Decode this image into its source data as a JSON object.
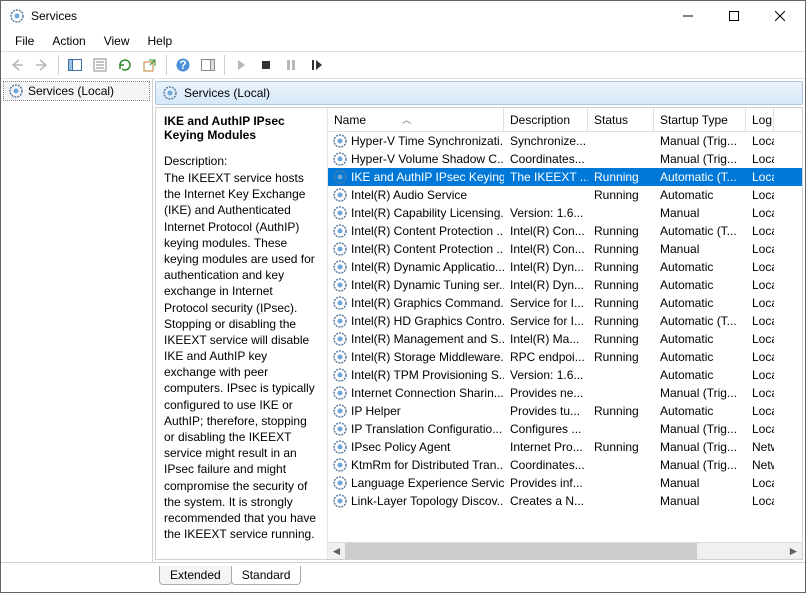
{
  "window": {
    "title": "Services"
  },
  "menu": {
    "file": "File",
    "action": "Action",
    "view": "View",
    "help": "Help"
  },
  "tree": {
    "root": "Services (Local)"
  },
  "panel": {
    "header": "Services (Local)"
  },
  "detail": {
    "title": "IKE and AuthIP IPsec Keying Modules",
    "desc_label": "Description:",
    "desc": "The IKEEXT service hosts the Internet Key Exchange (IKE) and Authenticated Internet Protocol (AuthIP) keying modules. These keying modules are used for authentication and key exchange in Internet Protocol security (IPsec). Stopping or disabling the IKEEXT service will disable IKE and AuthIP key exchange with peer computers. IPsec is typically configured to use IKE or AuthIP; therefore, stopping or disabling the IKEEXT service might result in an IPsec failure and might compromise the security of the system. It is strongly recommended that you have the IKEEXT service running."
  },
  "columns": {
    "name": "Name",
    "desc": "Description",
    "status": "Status",
    "start": "Startup Type",
    "logon": "Log"
  },
  "rows": [
    {
      "name": "Hyper-V Time Synchronizati...",
      "desc": "Synchronize...",
      "status": "",
      "start": "Manual (Trig...",
      "logon": "Loca"
    },
    {
      "name": "Hyper-V Volume Shadow C...",
      "desc": "Coordinates...",
      "status": "",
      "start": "Manual (Trig...",
      "logon": "Loca"
    },
    {
      "name": "IKE and AuthIP IPsec Keying...",
      "desc": "The IKEEXT ...",
      "status": "Running",
      "start": "Automatic (T...",
      "logon": "Loca",
      "selected": true
    },
    {
      "name": "Intel(R) Audio Service",
      "desc": "",
      "status": "Running",
      "start": "Automatic",
      "logon": "Loca"
    },
    {
      "name": "Intel(R) Capability Licensing...",
      "desc": "Version: 1.6...",
      "status": "",
      "start": "Manual",
      "logon": "Loca"
    },
    {
      "name": "Intel(R) Content Protection ...",
      "desc": "Intel(R) Con...",
      "status": "Running",
      "start": "Automatic (T...",
      "logon": "Loca"
    },
    {
      "name": "Intel(R) Content Protection ...",
      "desc": "Intel(R) Con...",
      "status": "Running",
      "start": "Manual",
      "logon": "Loca"
    },
    {
      "name": "Intel(R) Dynamic Applicatio...",
      "desc": "Intel(R) Dyn...",
      "status": "Running",
      "start": "Automatic",
      "logon": "Loca"
    },
    {
      "name": "Intel(R) Dynamic Tuning ser...",
      "desc": "Intel(R) Dyn...",
      "status": "Running",
      "start": "Automatic",
      "logon": "Loca"
    },
    {
      "name": "Intel(R) Graphics Command...",
      "desc": "Service for I...",
      "status": "Running",
      "start": "Automatic",
      "logon": "Loca"
    },
    {
      "name": "Intel(R) HD Graphics Contro...",
      "desc": "Service for I...",
      "status": "Running",
      "start": "Automatic (T...",
      "logon": "Loca"
    },
    {
      "name": "Intel(R) Management and S...",
      "desc": "Intel(R) Ma...",
      "status": "Running",
      "start": "Automatic",
      "logon": "Loca"
    },
    {
      "name": "Intel(R) Storage Middleware...",
      "desc": "RPC endpoi...",
      "status": "Running",
      "start": "Automatic",
      "logon": "Loca"
    },
    {
      "name": "Intel(R) TPM Provisioning S...",
      "desc": "Version: 1.6...",
      "status": "",
      "start": "Automatic",
      "logon": "Loca"
    },
    {
      "name": "Internet Connection Sharin...",
      "desc": "Provides ne...",
      "status": "",
      "start": "Manual (Trig...",
      "logon": "Loca"
    },
    {
      "name": "IP Helper",
      "desc": "Provides tu...",
      "status": "Running",
      "start": "Automatic",
      "logon": "Loca"
    },
    {
      "name": "IP Translation Configuratio...",
      "desc": "Configures ...",
      "status": "",
      "start": "Manual (Trig...",
      "logon": "Loca"
    },
    {
      "name": "IPsec Policy Agent",
      "desc": "Internet Pro...",
      "status": "Running",
      "start": "Manual (Trig...",
      "logon": "Netw"
    },
    {
      "name": "KtmRm for Distributed Tran...",
      "desc": "Coordinates...",
      "status": "",
      "start": "Manual (Trig...",
      "logon": "Netw"
    },
    {
      "name": "Language Experience Service",
      "desc": "Provides inf...",
      "status": "",
      "start": "Manual",
      "logon": "Loca"
    },
    {
      "name": "Link-Layer Topology Discov...",
      "desc": "Creates a N...",
      "status": "",
      "start": "Manual",
      "logon": "Loca"
    }
  ],
  "tabs": {
    "extended": "Extended",
    "standard": "Standard"
  }
}
